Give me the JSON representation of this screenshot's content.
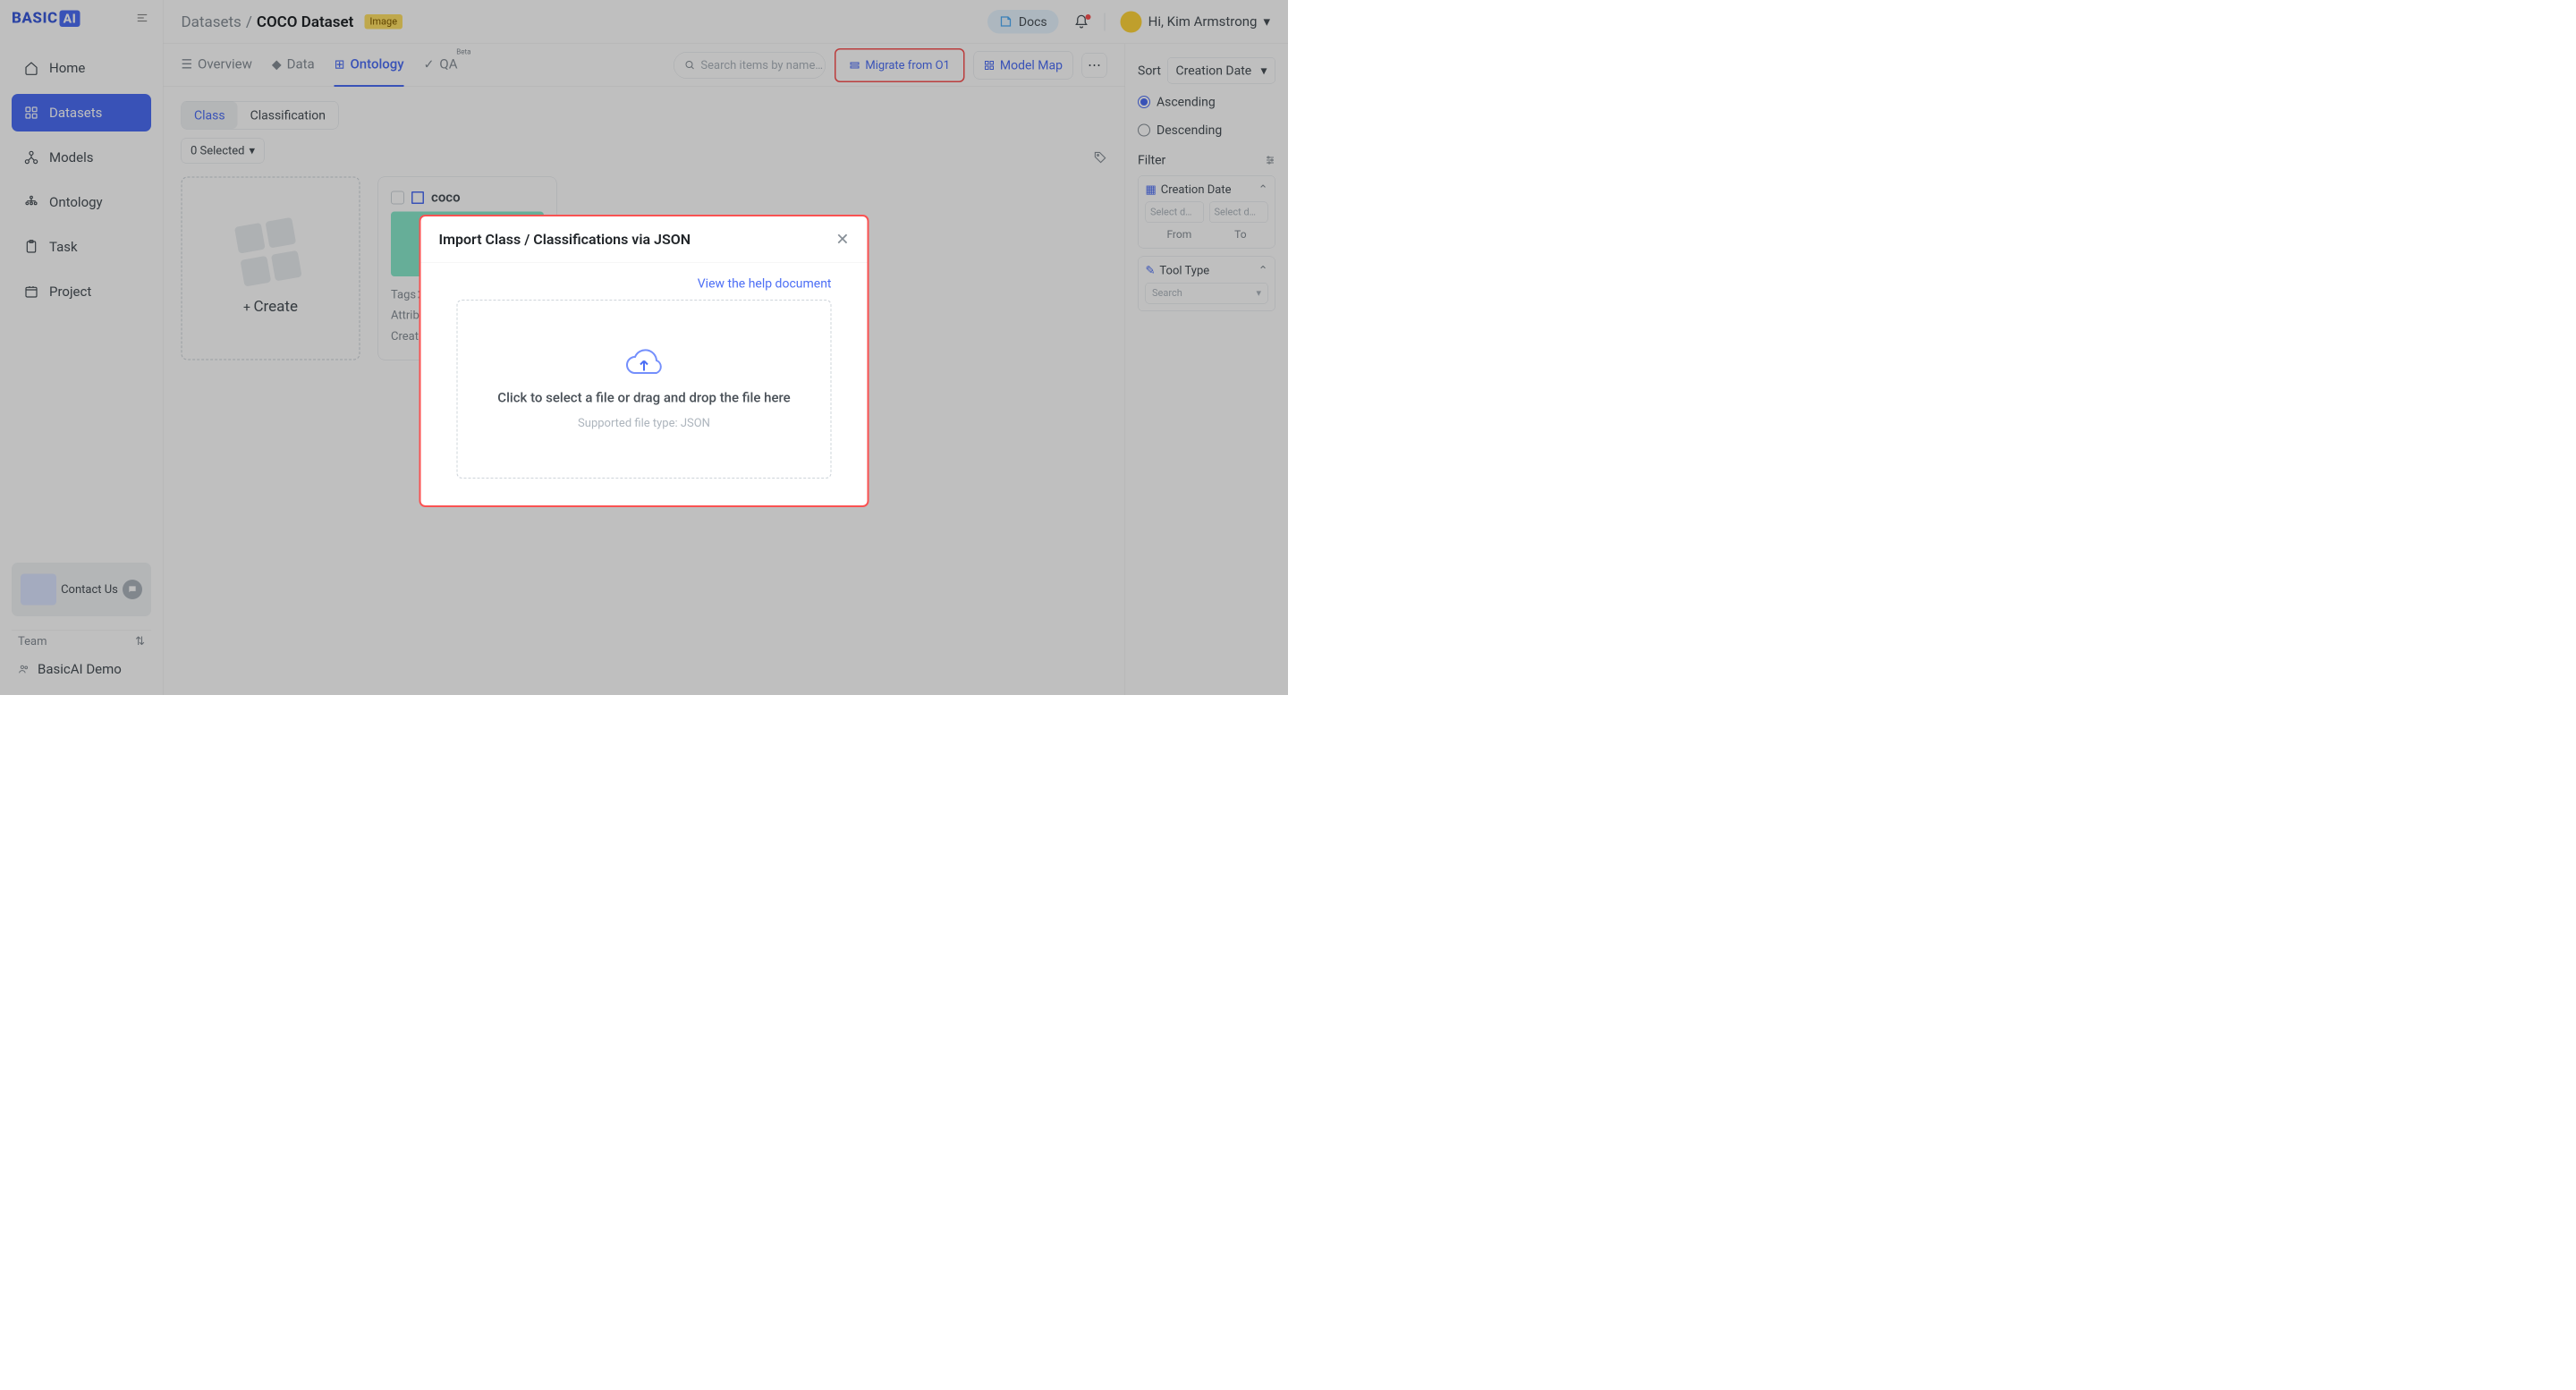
{
  "sidebar": {
    "logo": "BASIC",
    "logo_suffix": "AI",
    "nav": [
      {
        "label": "Home",
        "icon": "home-icon"
      },
      {
        "label": "Datasets",
        "icon": "datasets-icon",
        "active": true
      },
      {
        "label": "Models",
        "icon": "models-icon"
      },
      {
        "label": "Ontology",
        "icon": "ontology-icon"
      },
      {
        "label": "Task",
        "icon": "task-icon"
      },
      {
        "label": "Project",
        "icon": "project-icon"
      }
    ],
    "contact": "Contact Us",
    "team_label": "Team",
    "team_name": "BasicAI Demo"
  },
  "breadcrumb": {
    "parent": "Datasets",
    "current": "COCO Dataset",
    "tag": "Image"
  },
  "topbar": {
    "docs": "Docs",
    "greeting": "Hi, Kim Armstrong"
  },
  "tabs": [
    {
      "label": "Overview"
    },
    {
      "label": "Data"
    },
    {
      "label": "Ontology",
      "active": true
    },
    {
      "label": "QA",
      "beta": "Beta"
    }
  ],
  "actions": {
    "search_placeholder": "Search items by name…",
    "migrate": "Migrate from O1",
    "model_map": "Model Map"
  },
  "sub_tabs": {
    "class": "Class",
    "classification": "Classification"
  },
  "selected": "0 Selected",
  "create": "Create",
  "card": {
    "name": "coco",
    "tags_label": "Tags：",
    "tags_value": "-",
    "attrs_label": "Attributes：",
    "created_label": "Created Da"
  },
  "right": {
    "sort_label": "Sort",
    "sort_value": "Creation Date",
    "asc": "Ascending",
    "desc": "Descending",
    "filter": "Filter",
    "creation_date": "Creation Date",
    "date_placeholder": "Select d…",
    "from": "From",
    "to": "To",
    "tool_type": "Tool Type",
    "tool_search": "Search"
  },
  "modal": {
    "title": "Import Class / Classifications via JSON",
    "help": "View the help document",
    "drop_text": "Click to select a file or drag and drop the file here",
    "supported": "Supported file type: JSON"
  }
}
